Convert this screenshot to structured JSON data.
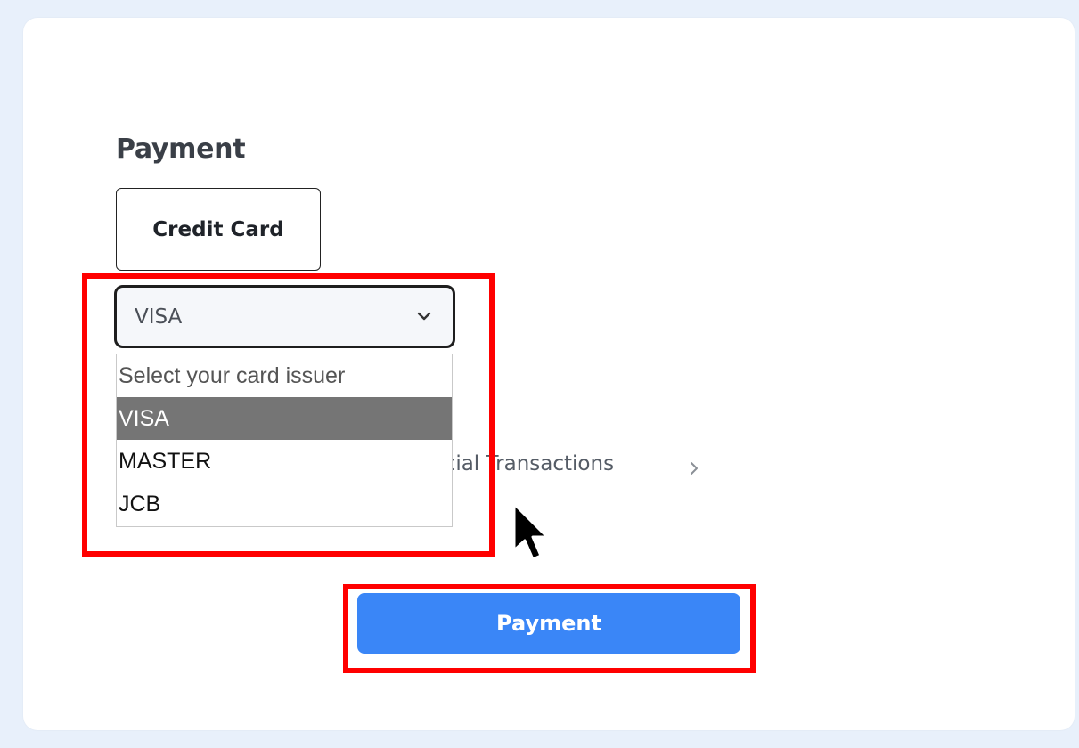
{
  "payment": {
    "title": "Payment",
    "method_tab_label": "Credit Card",
    "card_issuer_select": {
      "selected_value": "VISA",
      "options": [
        {
          "label": "Select your card issuer",
          "placeholder": true
        },
        {
          "label": "VISA",
          "selected": true
        },
        {
          "label": "MASTER"
        },
        {
          "label": "JCB"
        }
      ]
    },
    "partially_hidden_link": "ancial Transactions",
    "submit_button_label": "Payment"
  },
  "icons": {
    "select_chevron": "chevron-down-icon",
    "link_chevron": "chevron-right-icon",
    "cursor": "mouse-pointer-icon"
  },
  "colors": {
    "page_background": "#e8f0fb",
    "card_background": "#ffffff",
    "primary_button": "#3a86f7",
    "selected_option": "#757575",
    "highlight_box": "#ff0000"
  }
}
